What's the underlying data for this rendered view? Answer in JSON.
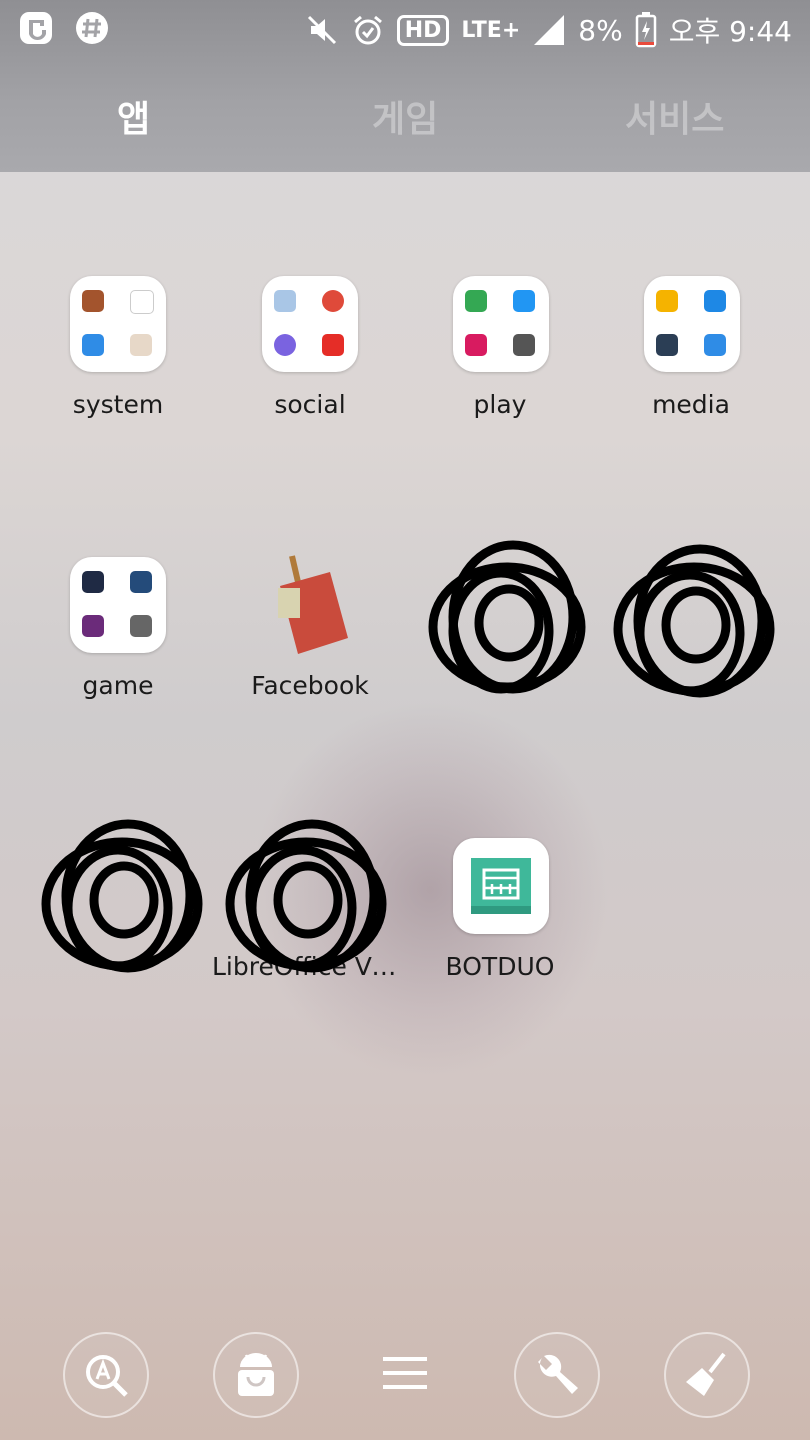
{
  "status_bar": {
    "icons_left": [
      "carrier-logo-icon",
      "slack-icon"
    ],
    "icons_right": [
      "mute-icon",
      "alarm-icon",
      "hd-icon",
      "lte-icon",
      "signal-icon"
    ],
    "hd_label": "HD",
    "network_label": "LTE+",
    "battery_percent": "8%",
    "time": "오후 9:44"
  },
  "tabs": [
    {
      "label": "앱",
      "active": true
    },
    {
      "label": "게임",
      "active": false
    },
    {
      "label": "서비스",
      "active": false
    }
  ],
  "apps": [
    {
      "label": "system"
    },
    {
      "label": "social"
    },
    {
      "label": "play"
    },
    {
      "label": "media"
    },
    {
      "label": "game"
    },
    {
      "label": "Facebook"
    },
    {
      "label": "BOTDUO"
    }
  ],
  "obscured_label_fragments": [
    "LibreOffice Vie..."
  ],
  "dock": {
    "items": [
      "search-apps-icon",
      "android-store-icon",
      "menu-icon",
      "wrench-icon",
      "broom-icon"
    ]
  },
  "colors": {
    "tab_bar": "#a2a2a6",
    "botduo_green": "#3fb89a",
    "scribble": "#000000"
  }
}
